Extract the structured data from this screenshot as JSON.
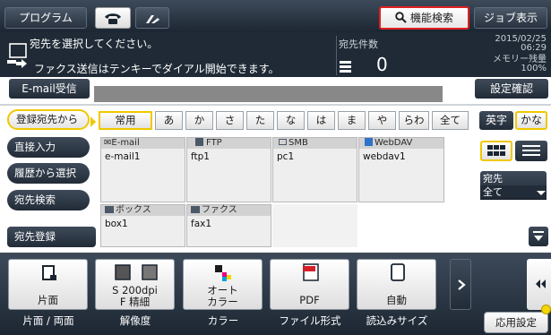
{
  "topbar": {
    "program_label": "プログラム",
    "phone_icon": "phone-icon",
    "fax_icon": "fax-mode-icon",
    "func_search_label": "機能検索",
    "job_label": "ジョブ表示"
  },
  "message": {
    "line1": "宛先を選択してください。",
    "line2": "ファクス送信はテンキーでダイアル開始できます。",
    "dest_count_label": "宛先件数",
    "dest_count_value": "0",
    "date": "2015/02/25",
    "time": "06:29",
    "memory_label": "メモリー残量",
    "memory_value": "100%"
  },
  "email_row": {
    "email_label": "E-mail受信",
    "confirm_label": "設定確認"
  },
  "left_menu": {
    "registered": "登録宛先から",
    "direct": "直接入力",
    "history": "履歴から選択",
    "search": "宛先検索",
    "register": "宛先登録"
  },
  "tabs": [
    "常用",
    "あ",
    "か",
    "さ",
    "た",
    "な",
    "は",
    "ま",
    "や",
    "らわ",
    "全て"
  ],
  "cells": [
    {
      "type": "E-mail",
      "name": "e-mail1",
      "icon": "email-icon"
    },
    {
      "type": "FTP",
      "name": "ftp1",
      "icon": "ftp-icon"
    },
    {
      "type": "SMB",
      "name": "pc1",
      "icon": "smb-icon"
    },
    {
      "type": "WebDAV",
      "name": "webdav1",
      "icon": "webdav-icon"
    },
    {
      "type": "ボックス",
      "name": "box1",
      "icon": "box-icon"
    },
    {
      "type": "ファクス",
      "name": "fax1",
      "icon": "fax-icon"
    }
  ],
  "right": {
    "alpha_label": "英字",
    "kana_label": "かな",
    "dest_label": "宛先",
    "dest_value": "全て"
  },
  "settings": [
    {
      "value": "片面",
      "caption": "片面 / 両面"
    },
    {
      "value1": "S 200dpi",
      "value2": "F 精細",
      "caption": "解像度"
    },
    {
      "value1": "オート",
      "value2": "カラー",
      "caption": "カラー"
    },
    {
      "value": "PDF",
      "caption": "ファイル形式"
    },
    {
      "value": "自動",
      "caption": "読込みサイズ"
    }
  ],
  "advanced_label": "応用設定",
  "colors": {
    "accent_yellow": "#f0c800",
    "func_border_red": "#e02020",
    "dark_panel": "#1f2a36"
  }
}
